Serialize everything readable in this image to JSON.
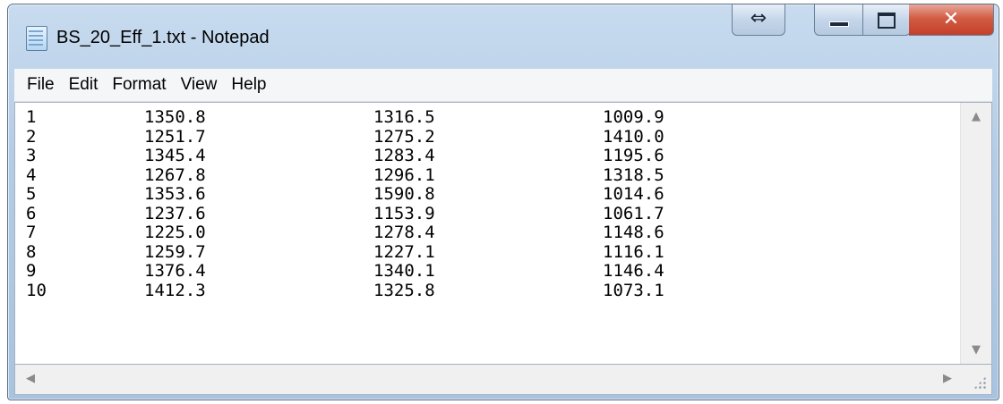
{
  "window": {
    "title": "BS_20_Eff_1.txt - Notepad",
    "icon": "notepad-icon",
    "controls": {
      "resize": "resize-arrows-icon",
      "minimize": "minimize-icon",
      "maximize": "maximize-icon",
      "close": "close-x-icon"
    }
  },
  "menu": {
    "items": [
      "File",
      "Edit",
      "Format",
      "View",
      "Help"
    ]
  },
  "document": {
    "rows": [
      [
        "1",
        "1350.8",
        "1316.5",
        "1009.9"
      ],
      [
        "2",
        "1251.7",
        "1275.2",
        "1410.0"
      ],
      [
        "3",
        "1345.4",
        "1283.4",
        "1195.6"
      ],
      [
        "4",
        "1267.8",
        "1296.1",
        "1318.5"
      ],
      [
        "5",
        "1353.6",
        "1590.8",
        "1014.6"
      ],
      [
        "6",
        "1237.6",
        "1153.9",
        "1061.7"
      ],
      [
        "7",
        "1225.0",
        "1278.4",
        "1148.6"
      ],
      [
        "8",
        "1259.7",
        "1227.1",
        "1116.1"
      ],
      [
        "9",
        "1376.4",
        "1340.1",
        "1146.4"
      ],
      [
        "10",
        "1412.3",
        "1325.8",
        "1073.1"
      ]
    ]
  },
  "colors": {
    "titlebar": "#b3cce6",
    "close": "#d25c44",
    "menubar": "#f5f6f7",
    "editor_bg": "#ffffff"
  }
}
